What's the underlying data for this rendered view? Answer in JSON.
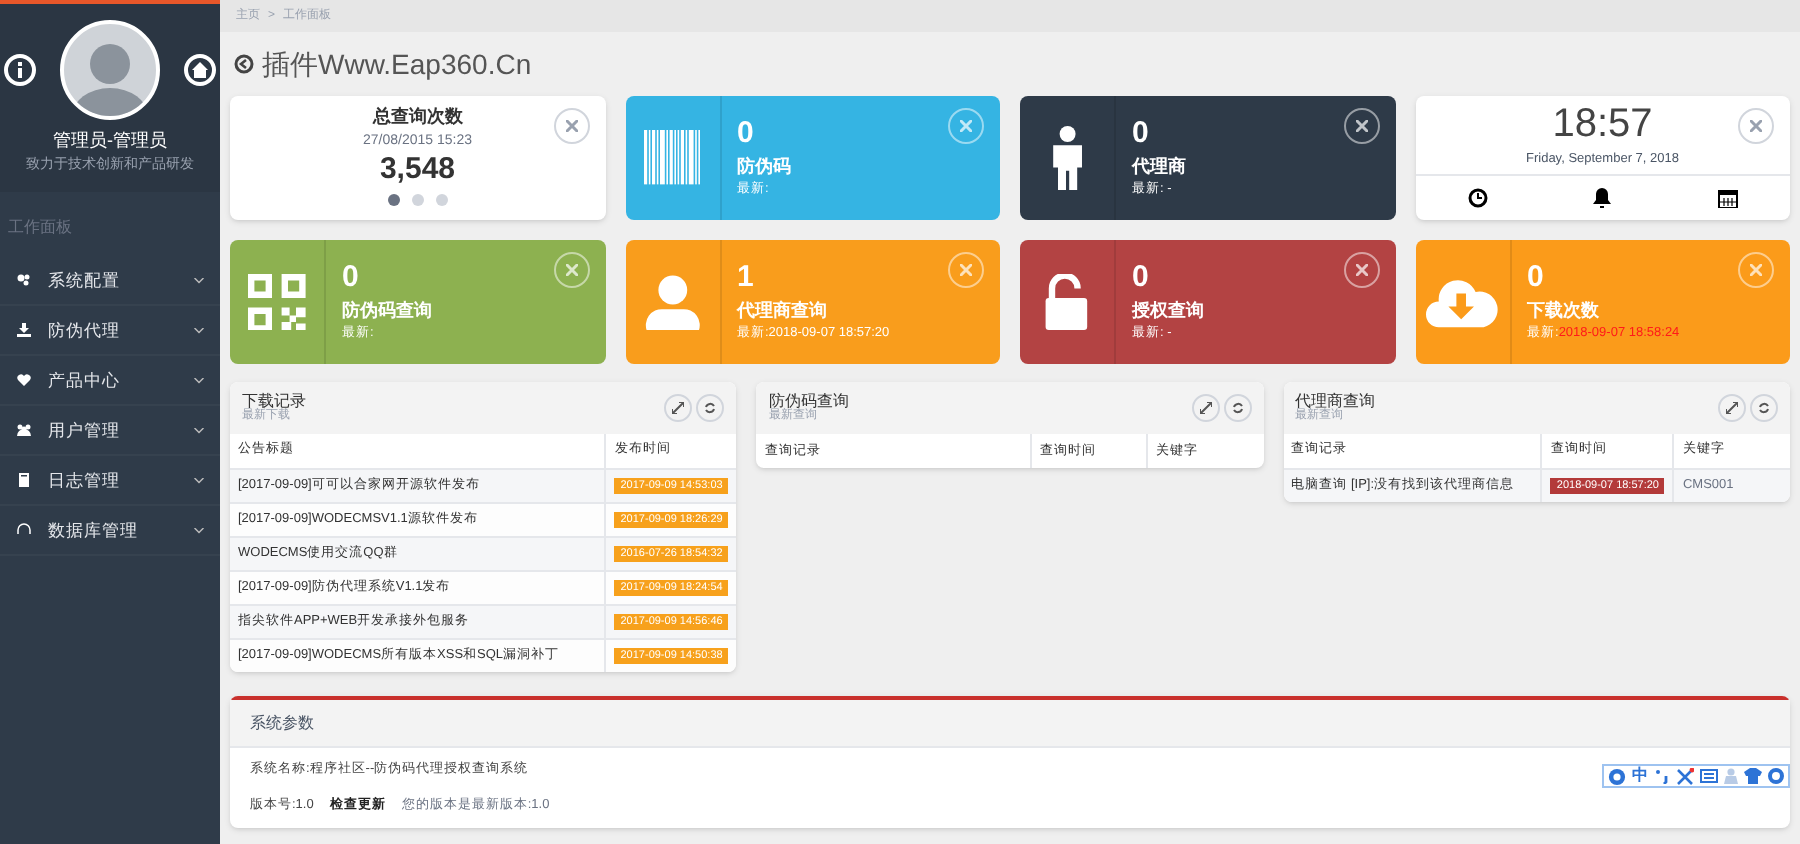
{
  "sidebar": {
    "user_name": "管理员-管理员",
    "user_motto": "致力于技术创新和产品研发",
    "section": "工作面板",
    "items": [
      {
        "label": "系统配置"
      },
      {
        "label": "防伪代理"
      },
      {
        "label": "产品中心"
      },
      {
        "label": "用户管理"
      },
      {
        "label": "日志管理"
      },
      {
        "label": "数据库管理"
      }
    ]
  },
  "breadcrumb": [
    "主页",
    ">",
    "工作面板"
  ],
  "page_title": "插件Www.Eap360.Cn",
  "tiles": [
    {
      "kind": "summary",
      "title": "总查询次数",
      "date": "27/08/2015 15:23",
      "value": "3,548",
      "dots": [
        {
          "selected": true
        },
        {
          "selected": false
        },
        {
          "selected": false
        }
      ]
    },
    {
      "kind": "stat",
      "color": "#35b4e3",
      "value": "0",
      "label": "防伪码",
      "latest": "最新:",
      "emphasis": false
    },
    {
      "kind": "stat",
      "color": "#2e3a48",
      "value": "0",
      "label": "代理商",
      "latest": "最新: -",
      "emphasis": false
    },
    {
      "kind": "clock",
      "time": "18:57",
      "date": "Friday, September 7, 2018"
    },
    {
      "kind": "stat",
      "color": "#8db150",
      "value": "0",
      "label": "防伪码查询",
      "latest": "最新:",
      "emphasis": false
    },
    {
      "kind": "stat",
      "color": "#f99d1c",
      "value": "1",
      "label": "代理商查询",
      "latest": "最新:2018-09-07 18:57:20",
      "emphasis": false
    },
    {
      "kind": "stat",
      "color": "#b34343",
      "value": "0",
      "label": "授权查询",
      "latest": "最新: -",
      "emphasis": false
    },
    {
      "kind": "stat",
      "color": "#fb9b1a",
      "value": "0",
      "label": "下载次数",
      "latest_prefix": "最新:",
      "latest": "2018-09-07 18:58:24",
      "emphasis": true
    }
  ],
  "panels": [
    {
      "title": "下载记录",
      "subtitle": "最新下载",
      "columns": [
        "公告标题",
        "发布时间"
      ],
      "rows": [
        {
          "cells": [
            "[2017-09-09]可可以合家网开源软件发布",
            "2017-09-09 14:53:03"
          ],
          "color": "#f7a11c"
        },
        {
          "cells": [
            "[2017-09-09]WODECMSV1.1源软件发布",
            "2017-09-09 18:26:29"
          ],
          "color": "#f7a11c"
        },
        {
          "cells": [
            "WODECMS使用交流QQ群",
            "2016-07-26 18:54:32"
          ],
          "color": "#f7a11c"
        },
        {
          "cells": [
            "[2017-09-09]防伪代理系统V1.1发布",
            "2017-09-09 18:24:54"
          ],
          "color": "#f7a11c"
        },
        {
          "cells": [
            "指尖软件APP+WEB开发承接外包服务",
            "2017-09-09 14:56:46"
          ],
          "color": "#f7a11c"
        },
        {
          "cells": [
            "[2017-09-09]WODECMS所有版本XSS和SQL漏洞补丁",
            "2017-09-09 14:50:38"
          ],
          "color": "#f7a11c"
        }
      ]
    },
    {
      "title": "防伪码查询",
      "subtitle": "最新查询",
      "columns": [
        "查询记录",
        "查询时间",
        "关键字"
      ]
    },
    {
      "title": "代理商查询",
      "subtitle": "最新查询",
      "columns": [
        "查询记录",
        "查询时间",
        "关键字"
      ],
      "rows": [
        {
          "cells": [
            "电脑查询 [IP]:没有找到该代理商信息",
            "2018-09-07 18:57:20",
            "CMS001"
          ],
          "color": "#b33a3a"
        }
      ]
    }
  ],
  "system": {
    "title": "系统参数",
    "name_line": "系统名称:程序社区--防伪码代理授权查询系统",
    "version": "版本号:1.0",
    "check_update": "检查更新",
    "status": "您的版本是最新版本:1.0"
  },
  "ime_toolbar": {
    "mode": "中"
  }
}
